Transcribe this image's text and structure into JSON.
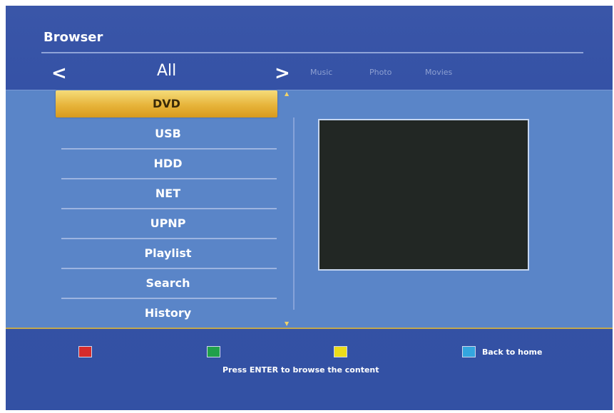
{
  "header": {
    "title": "Browser",
    "nav_prev": "<",
    "nav_next": ">",
    "current_category": "All",
    "tabs": [
      "Music",
      "Photo",
      "Movies"
    ]
  },
  "sources": {
    "items": [
      "DVD",
      "USB",
      "HDD",
      "NET",
      "UPNP",
      "Playlist",
      "Search",
      "History"
    ],
    "selected": "DVD"
  },
  "footer": {
    "keys": [
      "red",
      "green",
      "yellow",
      "blue"
    ],
    "blue_label": "Back to home",
    "hint": "Press ENTER to browse the content"
  },
  "colors": {
    "background": "#3552a6",
    "panel": "#5a85c8",
    "highlight": "#e7b43a",
    "preview": "#222724"
  }
}
